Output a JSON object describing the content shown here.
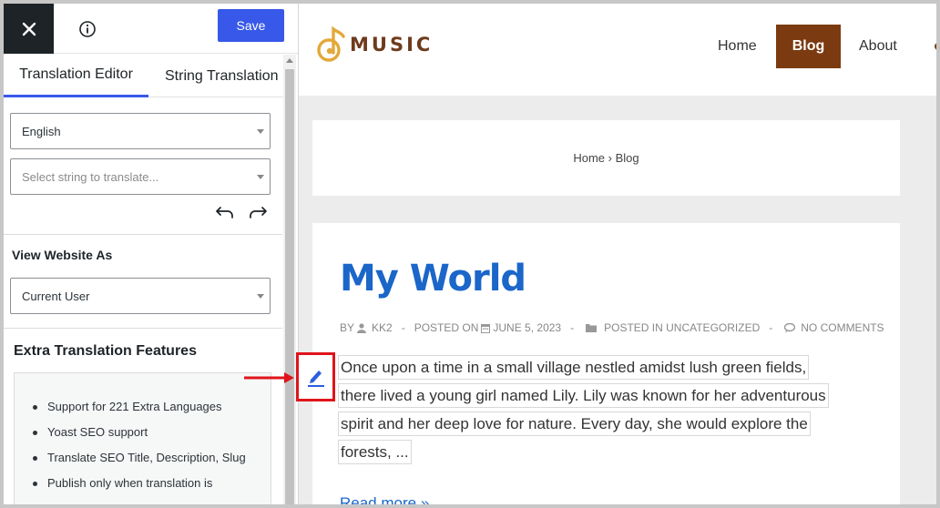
{
  "panel": {
    "save_label": "Save",
    "tabs": [
      {
        "label": "Translation Editor"
      },
      {
        "label": "String Translation"
      }
    ],
    "language_select": {
      "value": "English"
    },
    "string_select": {
      "placeholder": "Select string to translate..."
    },
    "view_as": {
      "label": "View Website As",
      "value": "Current User"
    },
    "extra": {
      "title": "Extra Translation Features",
      "items": [
        "Support for 221 Extra Languages",
        "Yoast SEO support",
        "Translate SEO Title, Description, Slug",
        "Publish only when translation is"
      ]
    }
  },
  "site": {
    "logo_text": "MUSIC",
    "nav": {
      "home": "Home",
      "blog": "Blog",
      "about": "About"
    },
    "breadcrumb": {
      "home": "Home",
      "sep": "›",
      "current": "Blog"
    },
    "post": {
      "title": "My World",
      "meta": {
        "by": "BY",
        "author": "KK2",
        "posted_on": "POSTED ON",
        "date": "JUNE 5, 2023",
        "posted_in": "POSTED IN UNCATEGORIZED",
        "comments": "NO COMMENTS",
        "dash": "-"
      },
      "excerpt_lines": [
        "Once upon a time in a small village nestled amidst lush green fields,",
        "there lived a young girl named Lily. Lily was known for her adventurous",
        "spirit and her deep love for nature. Every day, she would explore the",
        "forests, ..."
      ],
      "read_more": "Read more »"
    }
  },
  "colors": {
    "save_button": "#3858e9",
    "active_tab_underline": "#3858e9",
    "nav_active": "#7b3a10",
    "post_title": "#1b66c9",
    "highlight_border": "#e0141b"
  }
}
